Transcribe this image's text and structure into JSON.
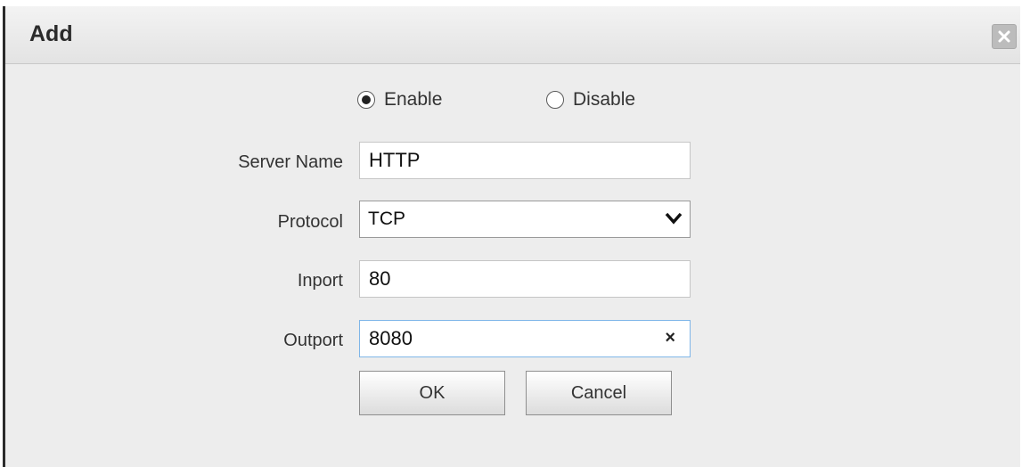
{
  "dialog": {
    "title": "Add",
    "close_icon": "close-icon"
  },
  "status": {
    "options": [
      {
        "label": "Enable",
        "selected": true
      },
      {
        "label": "Disable",
        "selected": false
      }
    ]
  },
  "form": {
    "server_name": {
      "label": "Server Name",
      "value": "HTTP"
    },
    "protocol": {
      "label": "Protocol",
      "value": "TCP"
    },
    "inport": {
      "label": "Inport",
      "value": "80"
    },
    "outport": {
      "label": "Outport",
      "value": "8080",
      "clear_glyph": "×"
    }
  },
  "buttons": {
    "ok": "OK",
    "cancel": "Cancel"
  },
  "colors": {
    "focus_border": "#7fb6e8",
    "dialog_bg": "#ededed"
  }
}
